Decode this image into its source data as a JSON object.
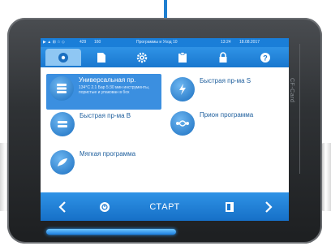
{
  "status_bar": {
    "left": "▶ ▲ ⊞ ☆ ◇",
    "code1": "429",
    "code2": "160",
    "title": "Программы и Уход 10",
    "time": "13:24",
    "date": "18.08.2017"
  },
  "tabs": [
    {
      "icon": "disc-icon"
    },
    {
      "icon": "document-icon"
    },
    {
      "icon": "gear-icon"
    },
    {
      "icon": "clipboard-icon"
    },
    {
      "icon": "lock-icon"
    },
    {
      "icon": "help-icon"
    }
  ],
  "programs": [
    {
      "label": "Универсальная пр.",
      "detail": "134°C 2.1 Бар 5:30 мин инструменты, пористые и упакован в бох",
      "icon": "stack-icon",
      "selected": true
    },
    {
      "label": "Быстрая пр-ма S",
      "icon": "lightning-icon",
      "selected": false
    },
    {
      "label": "Быстрая пр-ма B",
      "icon": "tray-icon",
      "selected": false
    },
    {
      "label": "Прион программа",
      "icon": "molecule-icon",
      "selected": false
    },
    {
      "label": "Мягкая программа",
      "icon": "feather-icon",
      "selected": false
    }
  ],
  "bottom_bar": {
    "start_label": "СТАРТ"
  },
  "device": {
    "cf_label": "CF-Card"
  },
  "colors": {
    "accent": "#1a7ed8",
    "selection": "#3b8fe0",
    "text": "#1f5f9d"
  }
}
